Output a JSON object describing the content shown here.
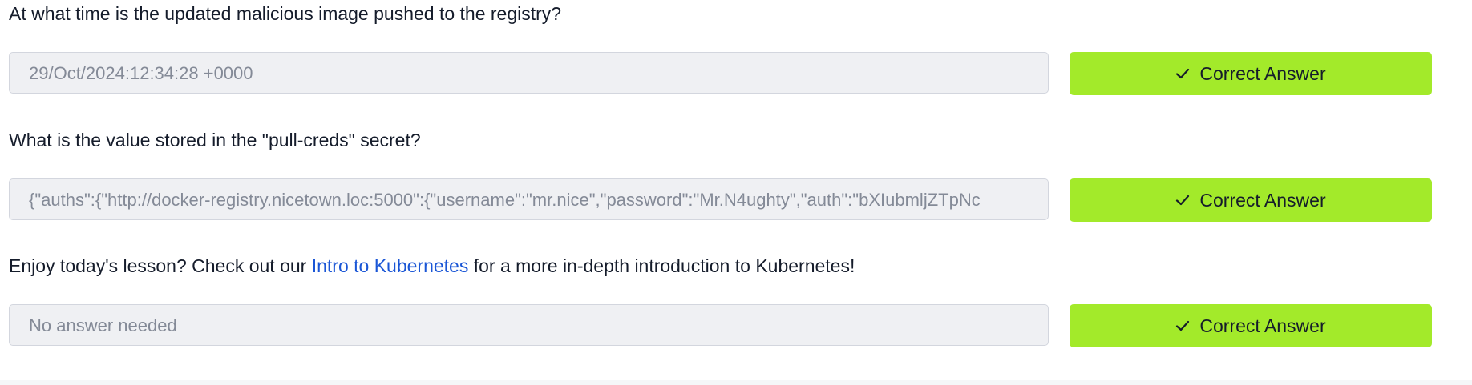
{
  "questions": [
    {
      "question": "At what time is the updated malicious image pushed to the registry?",
      "answer": "29/Oct/2024:12:34:28 +0000",
      "button_label": "Correct Answer"
    },
    {
      "question": "What is the value stored in the \"pull-creds\" secret?",
      "answer": "{\"auths\":{\"http://docker-registry.nicetown.loc:5000\":{\"username\":\"mr.nice\",\"password\":\"Mr.N4ughty\",\"auth\":\"bXIubmljZTpNc",
      "button_label": "Correct Answer"
    },
    {
      "question_prefix": "Enjoy today's lesson? Check out our ",
      "question_link": "Intro to Kubernetes",
      "question_suffix": " for a more in-depth introduction to Kubernetes!",
      "answer": "No answer needed",
      "button_label": "Correct Answer"
    }
  ],
  "colors": {
    "button_bg": "#a3ea2a",
    "field_bg": "#eff0f3",
    "link": "#1a56d6",
    "text": "#151c2b"
  },
  "icons": {
    "button_icon": "check-icon"
  }
}
